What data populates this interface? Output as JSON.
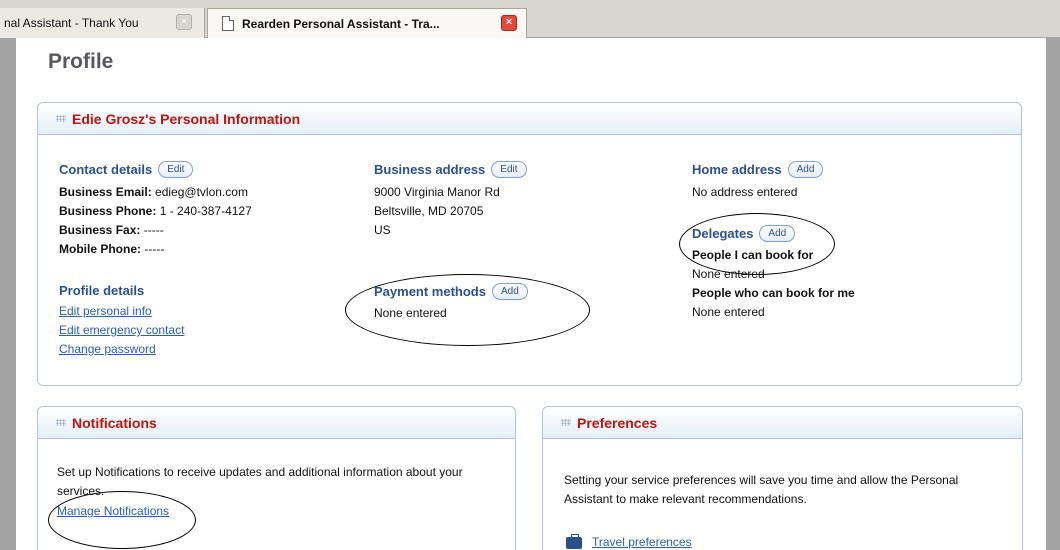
{
  "browser": {
    "tab1_title": "nal Assistant - Thank You",
    "tab2_title": "Rearden Personal Assistant - Tra...",
    "close_glyph": "×"
  },
  "page": {
    "title": "Profile"
  },
  "personal": {
    "title": "Edie Grosz's Personal Information",
    "contact": {
      "heading": "Contact details",
      "action": "Edit",
      "email_label": "Business Email:",
      "email_value": "edieg@tvlon.com",
      "phone_label": "Business Phone:",
      "phone_value": "1 - 240-387-4127",
      "fax_label": "Business Fax:",
      "fax_value": "-----",
      "mobile_label": "Mobile Phone:",
      "mobile_value": "-----"
    },
    "profile": {
      "heading": "Profile details",
      "links": [
        "Edit personal info",
        "Edit emergency contact",
        "Change password"
      ]
    },
    "business_address": {
      "heading": "Business address",
      "action": "Edit",
      "line1": "9000 Virginia Manor Rd",
      "line2": "Beltsville, MD 20705",
      "line3": "US"
    },
    "payment": {
      "heading": "Payment methods",
      "action": "Add",
      "status": "None entered"
    },
    "home_address": {
      "heading": "Home address",
      "action": "Add",
      "status": "No address entered"
    },
    "delegates": {
      "heading": "Delegates",
      "action": "Add",
      "book_for_label": "People I can book for",
      "book_for_status": "None entered",
      "book_me_label": "People who can book for me",
      "book_me_status": "None entered"
    }
  },
  "notifications": {
    "title": "Notifications",
    "text": "Set up Notifications to receive updates and additional information about your services.",
    "link": "Manage Notifications"
  },
  "preferences": {
    "title": "Preferences",
    "text": "Setting your service preferences will save you time and allow the Personal Assistant to make relevant recommendations.",
    "link": "Travel preferences",
    "link_icon": "suitcase-icon"
  },
  "colors": {
    "panel_title": "#c0140d",
    "heading": "#2c4f92",
    "link": "#2a5fb8"
  }
}
